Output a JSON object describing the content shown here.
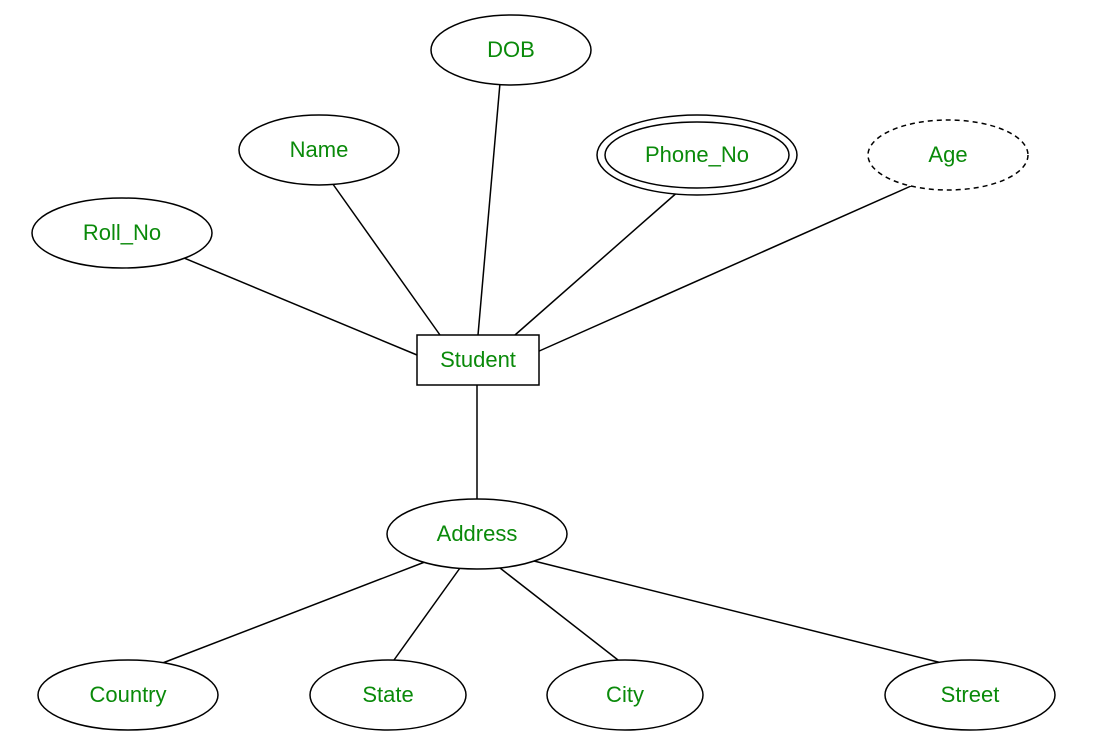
{
  "entity": {
    "name": "Student"
  },
  "attributes": {
    "roll_no": "Roll_No",
    "name": "Name",
    "dob": "DOB",
    "phone_no": "Phone_No",
    "age": "Age",
    "address": "Address"
  },
  "subAttributes": {
    "country": "Country",
    "state": "State",
    "city": "City",
    "street": "Street"
  }
}
